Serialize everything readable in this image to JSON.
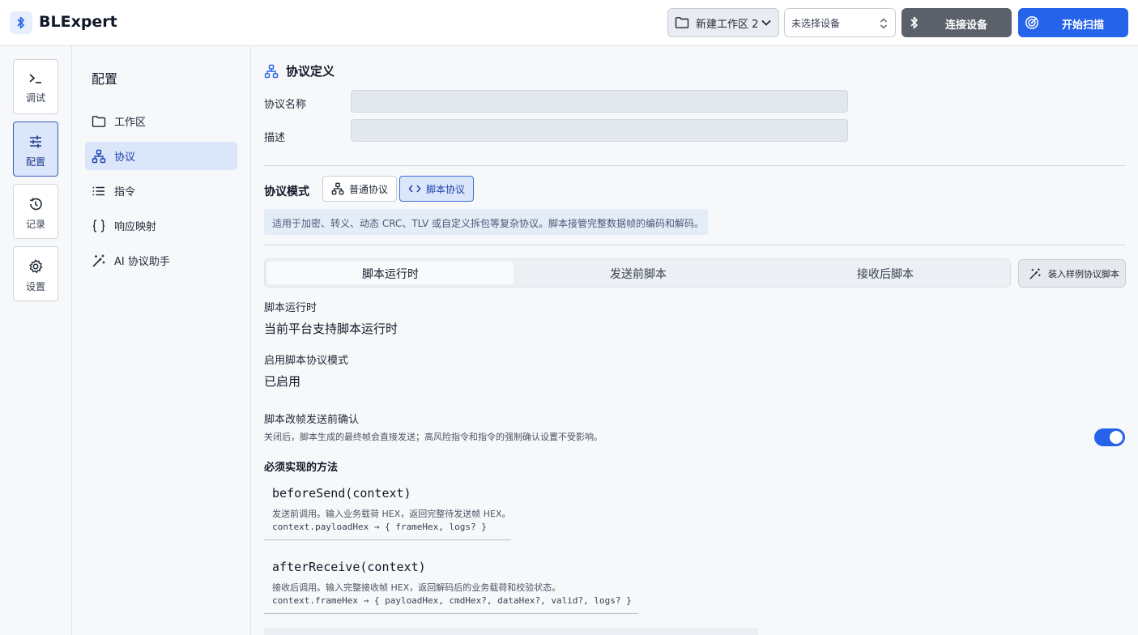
{
  "app": {
    "title": "BLExpert"
  },
  "header": {
    "workspace": "新建工作区 2",
    "device": "未选择设备",
    "connect_label": "连接设备",
    "scan_label": "开始扫描"
  },
  "rail": {
    "items": [
      {
        "label": "调试",
        "icon": "terminal-icon"
      },
      {
        "label": "配置",
        "icon": "sliders-icon",
        "active": true
      },
      {
        "label": "记录",
        "icon": "history-icon"
      },
      {
        "label": "设置",
        "icon": "gear-icon"
      }
    ]
  },
  "config_nav": {
    "title": "配置",
    "items": [
      {
        "label": "工作区",
        "icon": "folder-icon"
      },
      {
        "label": "协议",
        "icon": "network-icon",
        "active": true
      },
      {
        "label": "指令",
        "icon": "list-icon"
      },
      {
        "label": "响应映射",
        "icon": "braces-icon"
      },
      {
        "label": "AI 协议助手",
        "icon": "magic-wand-icon"
      }
    ]
  },
  "protocol": {
    "section_title": "协议定义",
    "name_label": "协议名称",
    "name_value": "",
    "desc_label": "描述",
    "desc_value": "",
    "mode_label": "协议模式",
    "modes": [
      {
        "label": "普通协议",
        "active": false
      },
      {
        "label": "脚本协议",
        "active": true
      }
    ],
    "info": "适用于加密、转义、动态 CRC、TLV 或自定义拆包等复杂协议。脚本接管完整数据帧的编码和解码。"
  },
  "tabs": [
    {
      "label": "脚本运行时",
      "active": true
    },
    {
      "label": "发送前脚本",
      "active": false
    },
    {
      "label": "接收后脚本",
      "active": false
    }
  ],
  "sample_button": "装入样例协议脚本",
  "runtime": {
    "runtime_label": "脚本运行时",
    "runtime_value": "当前平台支持脚本运行时",
    "enabled_label": "启用脚本协议模式",
    "enabled_value": "已启用",
    "confirm_label": "脚本改帧发送前确认",
    "confirm_desc": "关闭后，脚本生成的最终帧会直接发送；高风险指令和指令的强制确认设置不受影响。",
    "confirm_on": true,
    "methods_title": "必须实现的方法",
    "methods": [
      {
        "signature": "beforeSend(context)",
        "description": "发送前调用。输入业务载荷 HEX，返回完整待发送帧 HEX。",
        "contract": "context.payloadHex → { frameHex, logs? }"
      },
      {
        "signature": "afterReceive(context)",
        "description": "接收后调用。输入完整接收帧 HEX，返回解码后的业务载荷和校验状态。",
        "contract": "context.frameHex → { payloadHex, cmdHex?, dataHex?, valid?, logs? }"
      }
    ]
  },
  "colors": {
    "accent": "#2563eb",
    "active_bg": "#dbe6fa",
    "connect_bg": "#5b616b"
  }
}
